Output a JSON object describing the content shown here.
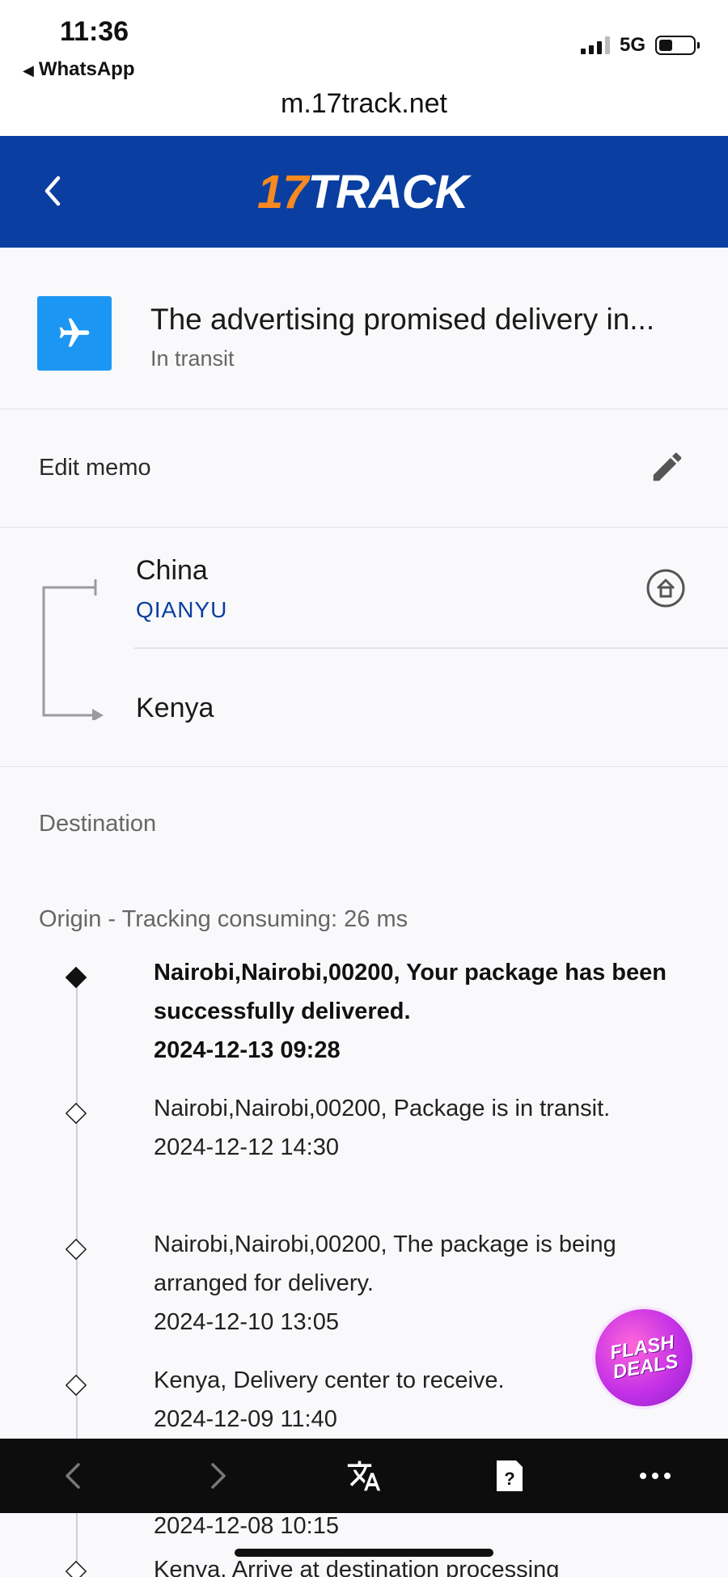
{
  "status_bar": {
    "time": "11:36",
    "back_app": "WhatsApp",
    "network": "5G",
    "signal_bars": 3,
    "battery_level_percent": 40
  },
  "browser": {
    "url": "m.17track.net"
  },
  "header": {
    "logo_num": "17",
    "logo_text": "TRACK",
    "back_icon": "chevron-left-icon",
    "colors": {
      "background": "#0a3fa1",
      "logo_accent": "#f6891f"
    }
  },
  "package": {
    "icon": "airplane-icon",
    "title": "The advertising promised delivery in...",
    "status": "In transit"
  },
  "memo": {
    "label": "Edit memo",
    "icon": "pencil-icon"
  },
  "route": {
    "from_country": "China",
    "carrier": "QIANYU",
    "to_country": "Kenya",
    "carrier_icon": "home-circle-icon"
  },
  "labels": {
    "destination": "Destination",
    "origin": "Origin - Tracking consuming: 26 ms"
  },
  "events": [
    {
      "text": "Nairobi,Nairobi,00200, Your package has been successfully delivered.",
      "date": "2024-12-13 09:28",
      "latest": true
    },
    {
      "text": "Nairobi,Nairobi,00200, Package is in transit.",
      "date": "2024-12-12 14:30",
      "latest": false
    },
    {
      "text": "Nairobi,Nairobi,00200, The package is being arranged for delivery.",
      "date": "2024-12-10 13:05",
      "latest": false
    },
    {
      "text": "Kenya, Delivery center to receive.",
      "date": "2024-12-09 11:40",
      "latest": false
    }
  ],
  "partial_events": {
    "date": "2024-12-08 10:15",
    "next_text": "Kenya, Arrive at destination processing"
  },
  "flash_deals": {
    "line1": "FLASH",
    "line2": "DEALS"
  },
  "bottom_bar": {
    "icons": [
      "back-icon",
      "forward-icon",
      "translate-icon",
      "help-icon",
      "more-icon"
    ]
  }
}
